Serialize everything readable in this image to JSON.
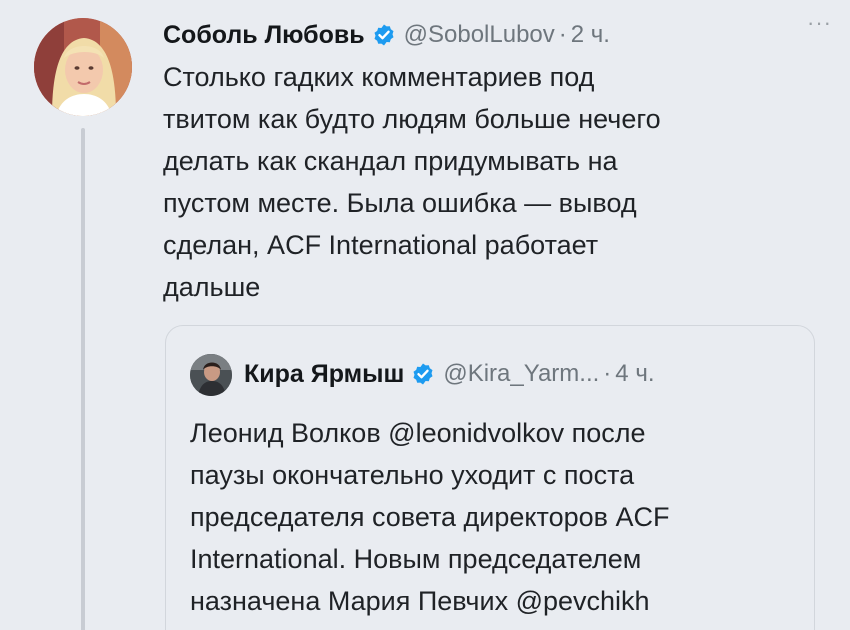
{
  "tweet": {
    "display_name": "Соболь Любовь",
    "handle": "@SobolLubov",
    "separator": "·",
    "time": "2 ч.",
    "more": "···",
    "text": "Столько гадких комментариев под\nтвитом как будто людям больше нечего\nделать как скандал придумывать на\nпустом месте. Была ошибка — вывод\nсделан, ACF International работает\nдальше"
  },
  "quote": {
    "display_name": "Кира Ярмыш",
    "handle": "@Kira_Yarm...",
    "separator": "·",
    "time": "4 ч.",
    "text": "Леонид Волков @leonidvolkov после\nпаузы окончательно уходит с поста\nпредседателя совета директоров ACF\nInternational. Новым председателем\nназначена Мария Певчих @pevchikh"
  },
  "icons": {
    "verified": "verified-badge-icon",
    "more": "more-options-icon"
  },
  "colors": {
    "background": "#e9ecf1",
    "verified_blue": "#1d9bf0",
    "muted_text": "#6e767d"
  }
}
